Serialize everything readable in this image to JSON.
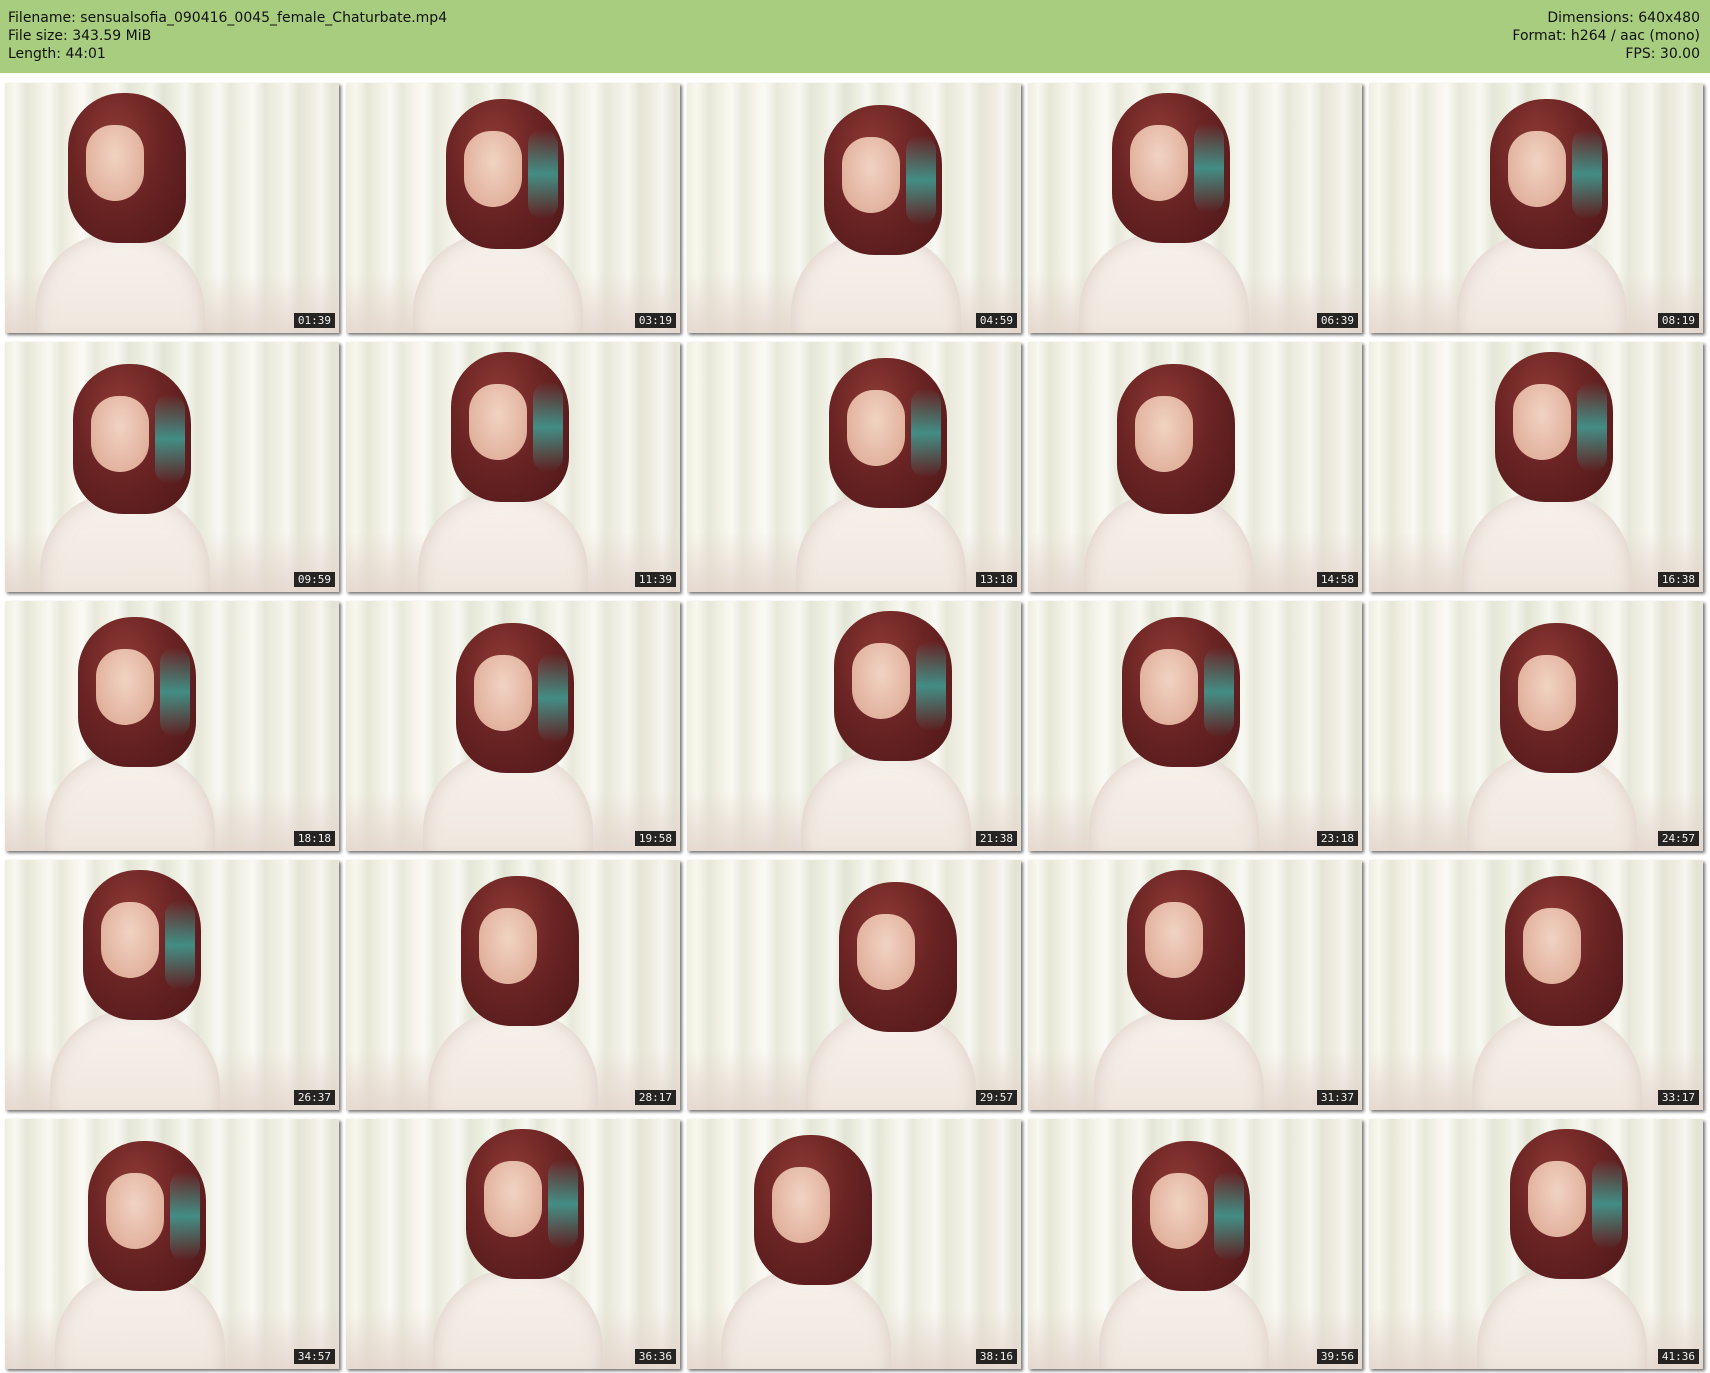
{
  "header": {
    "filename_line": "Filename: sensualsofia_090416_0045_female_Chaturbate.mp4",
    "filesize_line": "File size: 343.59 MiB",
    "length_line": "Length: 44:01",
    "dimensions_line": "Dimensions: 640x480",
    "format_line": "Format: h264 / aac (mono)",
    "fps_line": "FPS: 30.00",
    "background_color": "#a9cd7e"
  },
  "thumbnails": [
    {
      "timestamp": "01:39",
      "has_streak": false
    },
    {
      "timestamp": "03:19",
      "has_streak": true
    },
    {
      "timestamp": "04:59",
      "has_streak": true
    },
    {
      "timestamp": "06:39",
      "has_streak": true
    },
    {
      "timestamp": "08:19",
      "has_streak": true
    },
    {
      "timestamp": "09:59",
      "has_streak": true
    },
    {
      "timestamp": "11:39",
      "has_streak": true
    },
    {
      "timestamp": "13:18",
      "has_streak": true
    },
    {
      "timestamp": "14:58",
      "has_streak": false
    },
    {
      "timestamp": "16:38",
      "has_streak": true
    },
    {
      "timestamp": "18:18",
      "has_streak": true
    },
    {
      "timestamp": "19:58",
      "has_streak": true
    },
    {
      "timestamp": "21:38",
      "has_streak": true
    },
    {
      "timestamp": "23:18",
      "has_streak": true
    },
    {
      "timestamp": "24:57",
      "has_streak": false
    },
    {
      "timestamp": "26:37",
      "has_streak": true
    },
    {
      "timestamp": "28:17",
      "has_streak": false
    },
    {
      "timestamp": "29:57",
      "has_streak": false
    },
    {
      "timestamp": "31:37",
      "has_streak": false
    },
    {
      "timestamp": "33:17",
      "has_streak": false
    },
    {
      "timestamp": "34:57",
      "has_streak": true
    },
    {
      "timestamp": "36:36",
      "has_streak": true
    },
    {
      "timestamp": "38:16",
      "has_streak": false
    },
    {
      "timestamp": "39:56",
      "has_streak": true
    },
    {
      "timestamp": "41:36",
      "has_streak": true
    }
  ]
}
